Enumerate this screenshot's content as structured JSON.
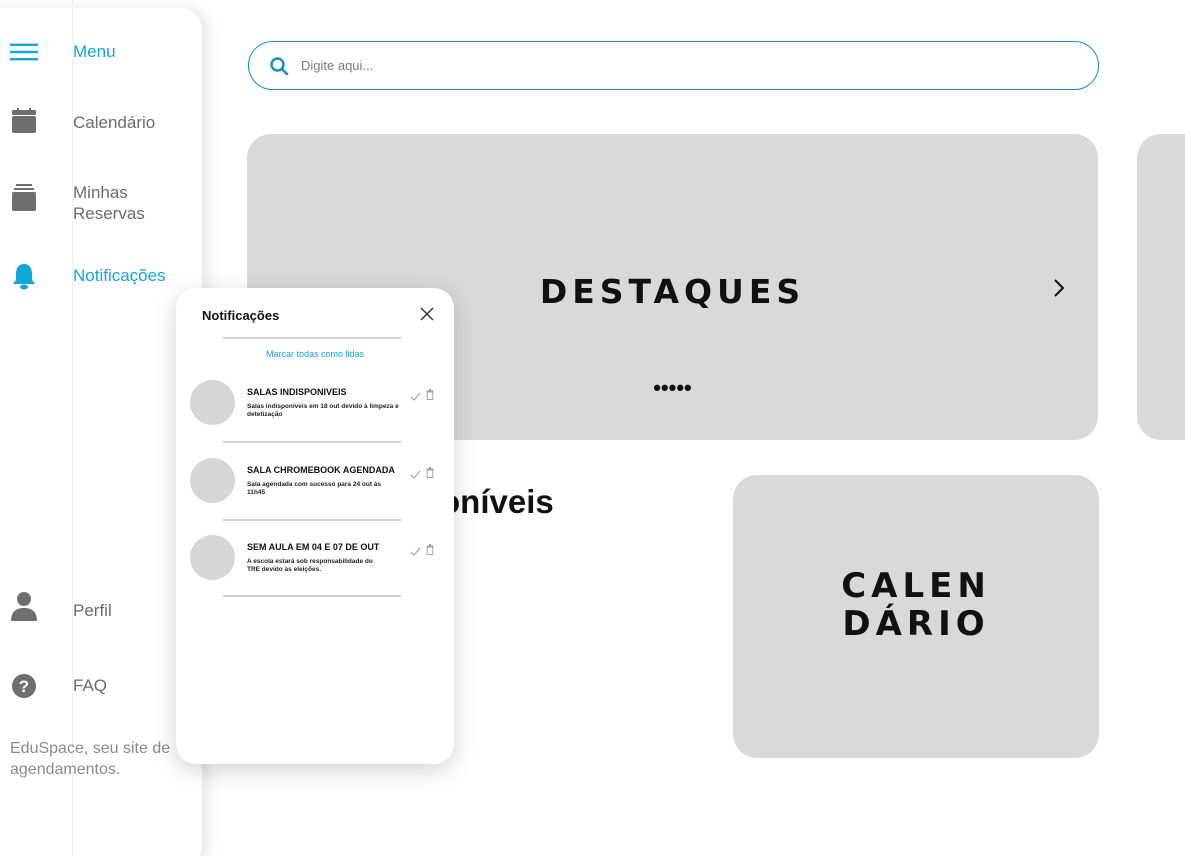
{
  "sidebar": {
    "menu_label": "Menu",
    "items": [
      {
        "label": "Calendário",
        "icon": "calendar-icon"
      },
      {
        "label": "Minhas\nReservas",
        "icon": "reservations-icon"
      },
      {
        "label": "Notificações",
        "icon": "bell-icon",
        "active": true
      },
      {
        "label": "Perfil",
        "icon": "user-icon"
      },
      {
        "label": "FAQ",
        "icon": "help-icon"
      }
    ],
    "tagline": "EduSpace, seu site de agendamentos."
  },
  "search": {
    "placeholder": "Digite aqui..."
  },
  "highlights": {
    "title": "DESTAQUES",
    "dots": "•••••"
  },
  "section_heading": "oníveis",
  "calendar_card": {
    "line1": "CALEN",
    "line2": "DÁRIO"
  },
  "notifications": {
    "title": "Notificações",
    "mark_all_read": "Marcar todas como lidas",
    "items": [
      {
        "title": "SALAS INDISPONIVEIS",
        "body": "Salas indisponíveis em 18 out devido à limpeza e detetização"
      },
      {
        "title": "SALA CHROMEBOOK AGENDADA",
        "body": "Sala agendada com sucesso para 24 out às 11h45"
      },
      {
        "title": "SEM AULA EM 04 E 07 DE OUT",
        "body": "A escola estará sob responsabilidade do TRE devido às eleições."
      }
    ]
  },
  "colors": {
    "accent": "#13a6d8",
    "search_border": "#1591be",
    "card": "#d9d9d9",
    "icon_gray": "#6e6e6e"
  }
}
